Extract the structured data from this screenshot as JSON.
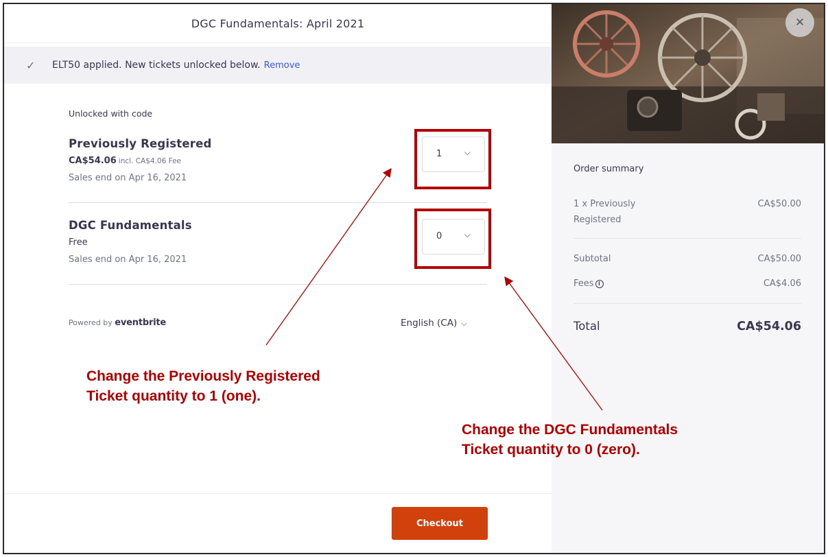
{
  "event": {
    "title": "DGC Fundamentals: April 2021"
  },
  "promo": {
    "message": "ELT50 applied. New tickets unlocked below.",
    "remove_label": "Remove"
  },
  "section_label": "Unlocked with code",
  "tickets": [
    {
      "name": "Previously Registered",
      "price": "CA$54.06",
      "fee_note": "incl. CA$4.06 Fee",
      "sales_end": "Sales end on Apr 16, 2021",
      "quantity": "1"
    },
    {
      "name": "DGC Fundamentals",
      "price": "Free",
      "fee_note": "",
      "sales_end": "Sales end on Apr 16, 2021",
      "quantity": "0"
    }
  ],
  "footer": {
    "powered_by": "Powered by",
    "brand": "eventbrite",
    "language": "English (CA)",
    "checkout_label": "Checkout"
  },
  "order_summary": {
    "title": "Order summary",
    "item_label": "1 x Previously Registered",
    "item_amount": "CA$50.00",
    "subtotal_label": "Subtotal",
    "subtotal_amount": "CA$50.00",
    "fees_label": "Fees",
    "fees_amount": "CA$4.06",
    "total_label": "Total",
    "total_amount": "CA$54.06"
  },
  "annotations": {
    "note1_line1": "Change the Previously Registered",
    "note1_line2": "Ticket quantity to 1 (one).",
    "note2_line1": "Change the DGC Fundamentals",
    "note2_line2": "Ticket quantity to 0 (zero)."
  },
  "colors": {
    "accent": "#d1410c",
    "annotation": "#b20000",
    "link": "#3659e3",
    "text": "#39364f"
  },
  "icons": {
    "check": "check-icon",
    "chevron": "chevron-down-icon",
    "close": "close-icon",
    "info": "info-icon"
  }
}
